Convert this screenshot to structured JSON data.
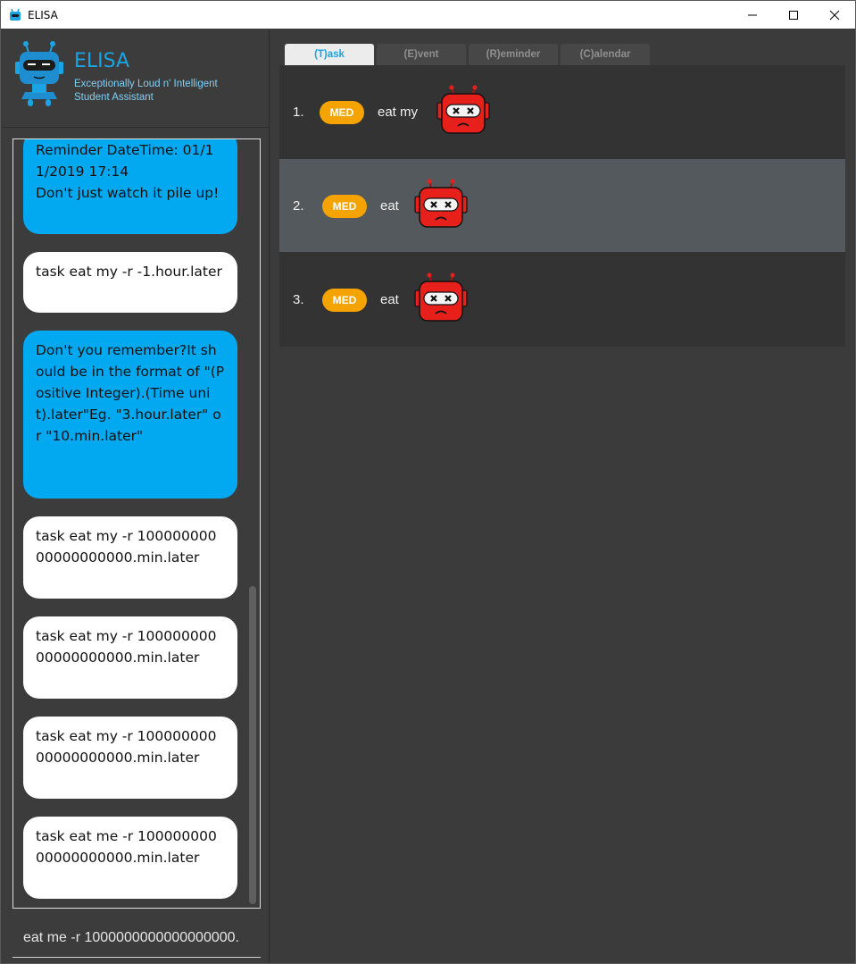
{
  "window": {
    "title": "ELISA",
    "controls": [
      "minimize-icon",
      "maximize-icon",
      "close-icon"
    ]
  },
  "header": {
    "name": "ELISA",
    "subtitle": "Exceptionally Loud n' Intelligent Student Assistant"
  },
  "chat": {
    "messages": [
      {
        "from": "bot",
        "text": "Reminder DateTime: 01/11/2019 17:14\nDon't just watch it pile up!"
      },
      {
        "from": "user",
        "text": "task eat my -r -1.hour.later"
      },
      {
        "from": "bot",
        "text": "Don't you remember?It should be in the format of \"(Positive Integer).(Time unit).later\"Eg. \"3.hour.later\" or \"10.min.later\""
      },
      {
        "from": "user",
        "text": "task eat my -r 10000000000000000000.min.later"
      },
      {
        "from": "user",
        "text": "task eat my -r 10000000000000000000.min.later"
      },
      {
        "from": "user",
        "text": "task eat my -r 10000000000000000000.min.later"
      },
      {
        "from": "user",
        "text": "task eat me -r 10000000000000000000.min.later"
      }
    ]
  },
  "input": {
    "value": "eat me -r 1000000000000000000."
  },
  "tabs": [
    {
      "label": "(T)ask",
      "active": true
    },
    {
      "label": "(E)vent",
      "active": false
    },
    {
      "label": "(R)eminder",
      "active": false
    },
    {
      "label": "(C)alendar",
      "active": false
    }
  ],
  "tasks": [
    {
      "index": "1.",
      "priority": "MED",
      "description": "eat my",
      "icon": "sad-robot-icon",
      "selected": false
    },
    {
      "index": "2.",
      "priority": "MED",
      "description": "eat",
      "icon": "sad-robot-icon",
      "selected": true
    },
    {
      "index": "3.",
      "priority": "MED",
      "description": "eat",
      "icon": "sad-robot-icon",
      "selected": false
    }
  ],
  "colors": {
    "accent": "#1aa4e3",
    "bot_bubble": "#03a9f0",
    "user_bubble": "#ffffff",
    "priority_med": "#f5a300",
    "robot": "#e8201c"
  }
}
